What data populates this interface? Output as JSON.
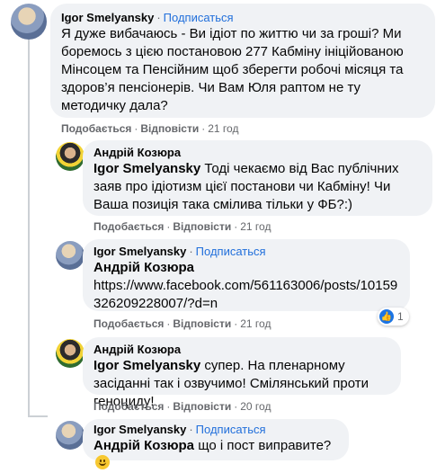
{
  "comments": [
    {
      "author": "Igor Smelyansky",
      "subscribe": "Подписаться",
      "text": "Я дуже вибачаюсь - Ви ідіот по життю чи за гроші? Ми боремось з цією постановою 277 Кабміну ініційованою Мінсоцем та Пенсійним щоб зберегти робочі місяця та здоров’я пенсіонерів. Чи Вам Юля раптом не ту методичку дала?",
      "like": "Подобається",
      "reply": "Відповісти",
      "time": "21 год"
    },
    {
      "author": "Андрій Козюра",
      "mention": "Igor Smelyansky",
      "text": "Тоді чекаємо від Вас публічних заяв про ідіотизм цієї постанови чи Кабміну! Чи Ваша позиція така смілива тільки у ФБ?:)",
      "like": "Подобається",
      "reply": "Відповісти",
      "time": "21 год"
    },
    {
      "author": "Igor Smelyansky",
      "subscribe": "Подписаться",
      "mention": "Андрій Козюра",
      "text": "https://www.facebook.com/561163006/posts/10159326209228007/?d=n",
      "like": "Подобається",
      "reply": "Відповісти",
      "time": "21 год",
      "reactions": "1"
    },
    {
      "author": "Андрій Козюра",
      "mention": "Igor Smelyansky",
      "text": "супер. На пленарному засіданні так і озвучимо! Смілянський проти геноциду!",
      "like": "Подобається",
      "reply": "Відповісти",
      "time": "20 год"
    },
    {
      "author": "Igor Smelyansky",
      "subscribe": "Подписаться",
      "mention": "Андрій Козюра",
      "text": "що і пост виправите?"
    }
  ],
  "separator": "·",
  "colors": {
    "bubble": "#f0f2f5",
    "link": "#216fdb",
    "meta": "#65676b",
    "like_blue": "#1b74e4"
  }
}
